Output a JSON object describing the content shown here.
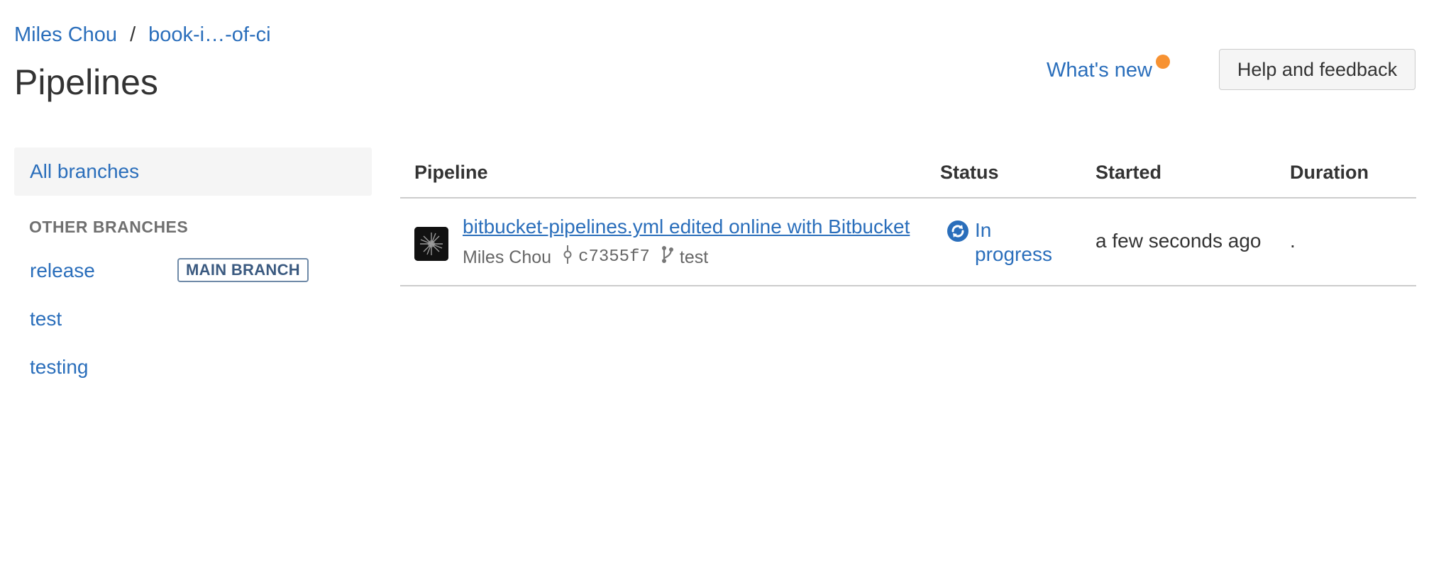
{
  "header": {
    "breadcrumb": {
      "owner": "Miles Chou",
      "separator": "/",
      "repo": "book-i…-of-ci"
    },
    "title": "Pipelines",
    "whats_new": "What's new",
    "whats_new_dot_color": "#f79232",
    "help_button": "Help and feedback"
  },
  "sidebar": {
    "all_branches": "All branches",
    "other_heading": "OTHER BRANCHES",
    "branches": [
      {
        "name": "release",
        "badge": "MAIN BRANCH"
      },
      {
        "name": "test"
      },
      {
        "name": "testing"
      }
    ]
  },
  "table": {
    "columns": [
      "Pipeline",
      "Status",
      "Started",
      "Duration"
    ],
    "rows": [
      {
        "avatar_icon": "avatar-icon",
        "title": "bitbucket-pipelines.yml edited online with Bitbucket",
        "author": "Miles Chou",
        "commit_icon": "commit-icon",
        "commit": "c7355f7",
        "branch_icon": "branch-icon",
        "branch": "test",
        "status_icon": "in-progress-icon",
        "status": "In progress",
        "started": "a few seconds ago",
        "duration": "."
      }
    ]
  },
  "colors": {
    "link": "#2a6ebb",
    "accent_dot": "#f79232",
    "divider": "#cccccc"
  }
}
